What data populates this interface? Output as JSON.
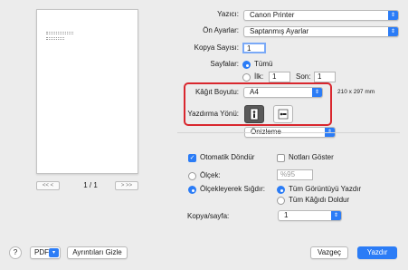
{
  "preview": {
    "page_indicator": "1 / 1"
  },
  "printer": {
    "label": "Yazıcı:",
    "value": "Canon Printer"
  },
  "presets": {
    "label": "Ön Ayarlar:",
    "value": "Saptanmış Ayarlar"
  },
  "copies": {
    "label": "Kopya Sayısı:",
    "value": "1"
  },
  "pages": {
    "label": "Sayfalar:",
    "all_label": "Tümü",
    "from_label": "İlk:",
    "from_value": "1",
    "to_label": "Son:",
    "to_value": "1"
  },
  "paper_size": {
    "label": "Kâğıt Boyutu:",
    "value": "A4",
    "dimensions": "210 x 297 mm"
  },
  "orientation": {
    "label": "Yazdırma Yönü:"
  },
  "section": {
    "value": "Önizleme"
  },
  "auto_rotate": {
    "label": "Otomatik Döndür",
    "checked": true
  },
  "show_notes": {
    "label": "Notları Göster",
    "checked": false
  },
  "scale": {
    "label": "Ölçek:",
    "value": "%95"
  },
  "scale_to_fit": {
    "label": "Ölçekleyerek Sığdır:",
    "print_entire": "Tüm Görüntüyü Yazdır",
    "fill_paper": "Tüm Kâğıdı Doldur"
  },
  "pages_per_sheet": {
    "label": "Kopya/sayfa:",
    "value": "1"
  },
  "footer": {
    "help": "?",
    "pdf": "PDF",
    "hide_details": "Ayrıntıları Gizle",
    "cancel": "Vazgeç",
    "print": "Yazdır"
  },
  "colors": {
    "accent": "#2b7cf6",
    "highlight": "#d9272e"
  }
}
